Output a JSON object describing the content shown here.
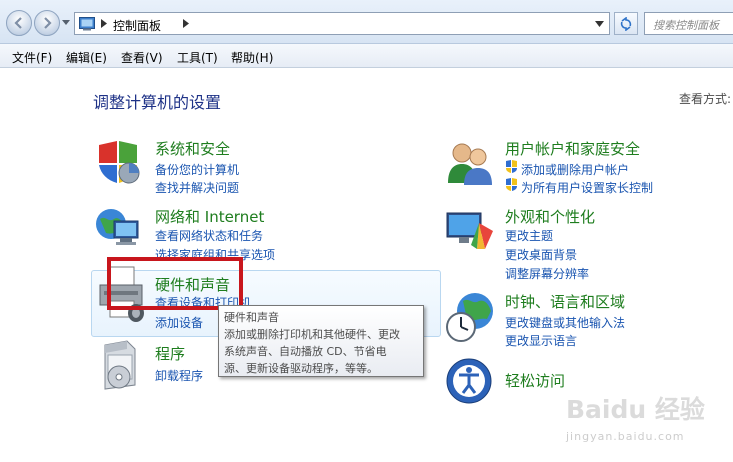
{
  "address_bar": {
    "path_root_label": "控制面板",
    "search_placeholder": "搜索控制面板"
  },
  "menu": {
    "file": "文件(F)",
    "edit": "编辑(E)",
    "view": "查看(V)",
    "tools": "工具(T)",
    "help": "帮助(H)"
  },
  "main": {
    "title": "调整计算机的设置",
    "view_by_label": "查看方式:",
    "left_categories": [
      {
        "title": "系统和安全",
        "icon": "shield-icon",
        "links": [
          "备份您的计算机",
          "查找并解决问题"
        ]
      },
      {
        "title": "网络和 Internet",
        "icon": "network-icon",
        "links": [
          "查看网络状态和任务",
          "选择家庭组和共享选项"
        ]
      },
      {
        "title": "硬件和声音",
        "icon": "printer-icon",
        "links": [
          "查看设备和打印机",
          "添加设备"
        ]
      },
      {
        "title": "程序",
        "icon": "programs-icon",
        "links": [
          "卸载程序"
        ]
      }
    ],
    "right_categories": [
      {
        "title": "用户帐户和家庭安全",
        "icon": "users-icon",
        "links": [
          "添加或删除用户帐户",
          "为所有用户设置家长控制"
        ]
      },
      {
        "title": "外观和个性化",
        "icon": "appearance-icon",
        "links": [
          "更改主题",
          "更改桌面背景",
          "调整屏幕分辨率"
        ]
      },
      {
        "title": "时钟、语言和区域",
        "icon": "globe-clock-icon",
        "links": [
          "更改键盘或其他输入法",
          "更改显示语言"
        ]
      },
      {
        "title": "轻松访问",
        "icon": "ease-of-access-icon",
        "links": []
      }
    ]
  },
  "tooltip": {
    "lines": [
      "硬件和声音",
      "添加或删除打印机和其他硬件、更改",
      "系统声音、自动播放 CD、节省电",
      "源、更新设备驱动程序，等等。"
    ]
  },
  "watermark": {
    "brand": "Baidu 经验",
    "url": "jingyan.baidu.com"
  },
  "colors": {
    "category_title": "#1e7d1e",
    "link": "#1a55b0",
    "page_title": "#1e3287",
    "highlight_frame": "#c8161d"
  }
}
